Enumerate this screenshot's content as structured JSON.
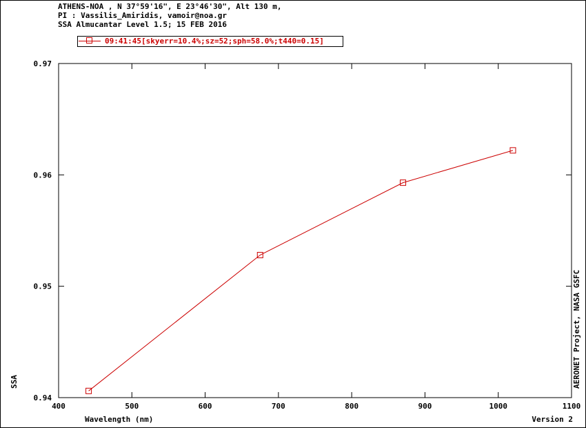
{
  "header": {
    "line1": "ATHENS-NOA , N 37°59'16\", E 23°46'30\", Alt 130 m,",
    "line2": "PI : Vassilis_Amiridis, vamoir@noa.gr",
    "line3": "SSA Almucantar Level 1.5; 15 FEB 2016"
  },
  "side_note": "AERONET Project, NASA GSFC",
  "version_label": "Version 2",
  "colors": {
    "series": "#cc0000",
    "axis": "#000000",
    "background": "#ffffff"
  },
  "chart_data": {
    "type": "line",
    "xlabel": "Wavelength (nm)",
    "ylabel": "SSA",
    "xlim": [
      400,
      1100
    ],
    "ylim": [
      0.94,
      0.97
    ],
    "xticks": [
      400,
      500,
      600,
      700,
      800,
      900,
      1000,
      1100
    ],
    "yticks": [
      0.94,
      0.95,
      0.96,
      0.97
    ],
    "ytick_labels": [
      "0.94",
      "0.95",
      "0.96",
      "0.97"
    ],
    "grid": false,
    "legend_position": "top-left",
    "series": [
      {
        "name": "09:41:45[skyerr=10.4%;sz=52;sph=58.0%;t440=0.15]",
        "marker": "square",
        "x": [
          441,
          675,
          870,
          1020
        ],
        "y": [
          0.9406,
          0.9528,
          0.9593,
          0.9622
        ]
      }
    ]
  }
}
